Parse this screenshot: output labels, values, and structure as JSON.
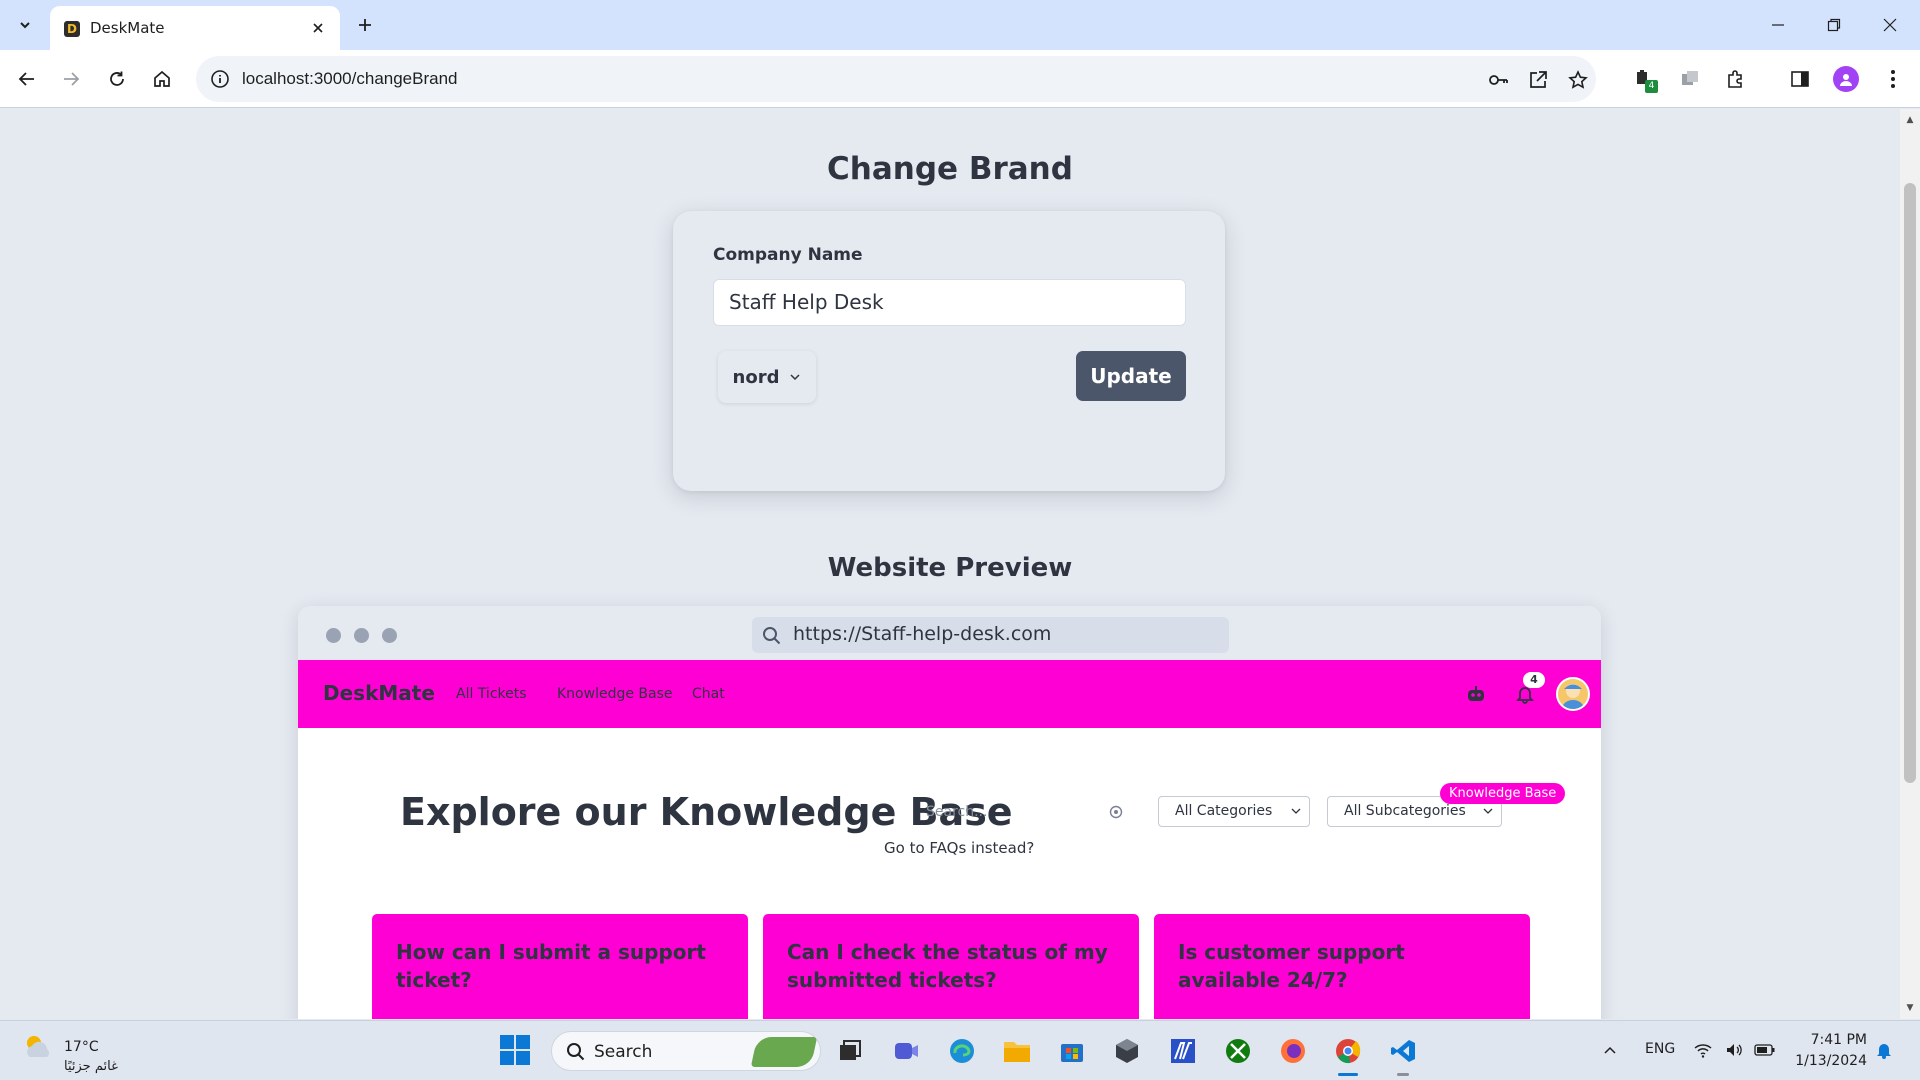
{
  "browser": {
    "tab_title": "DeskMate",
    "tab_favicon_letter": "D",
    "url": "localhost:3000/changeBrand",
    "extension_badge": "4"
  },
  "page": {
    "title": "Change Brand",
    "form": {
      "company_label": "Company Name",
      "company_value": "Staff Help Desk",
      "theme_selected": "nord",
      "update_label": "Update"
    },
    "preview_title": "Website Preview"
  },
  "preview": {
    "url": "https://Staff-help-desk.com",
    "brand": "DeskMate",
    "nav_links": [
      "All Tickets",
      "Knowledge Base",
      "Chat"
    ],
    "notification_count": "4",
    "kb_title": "Explore our Knowledge Base",
    "search_placeholder": "Search...",
    "faq_link": "Go to FAQs instead?",
    "category_select": "All Categories",
    "subcategory_select": "All Subcategories",
    "badge": "Knowledge Base",
    "cards": [
      "How can I submit a support ticket?",
      "Can I check the status of my submitted tickets?",
      "Is customer support available 24/7?"
    ],
    "accent_color": "#ff00d4"
  },
  "taskbar": {
    "weather_temp": "17°C",
    "weather_cond": "غائم جزئيًا",
    "search_label": "Search",
    "lang": "ENG",
    "time": "7:41 PM",
    "date": "1/13/2024"
  },
  "colors": {
    "page_bg": "#e5e9f0",
    "button_bg": "#4c566a",
    "text": "#2e3440"
  }
}
